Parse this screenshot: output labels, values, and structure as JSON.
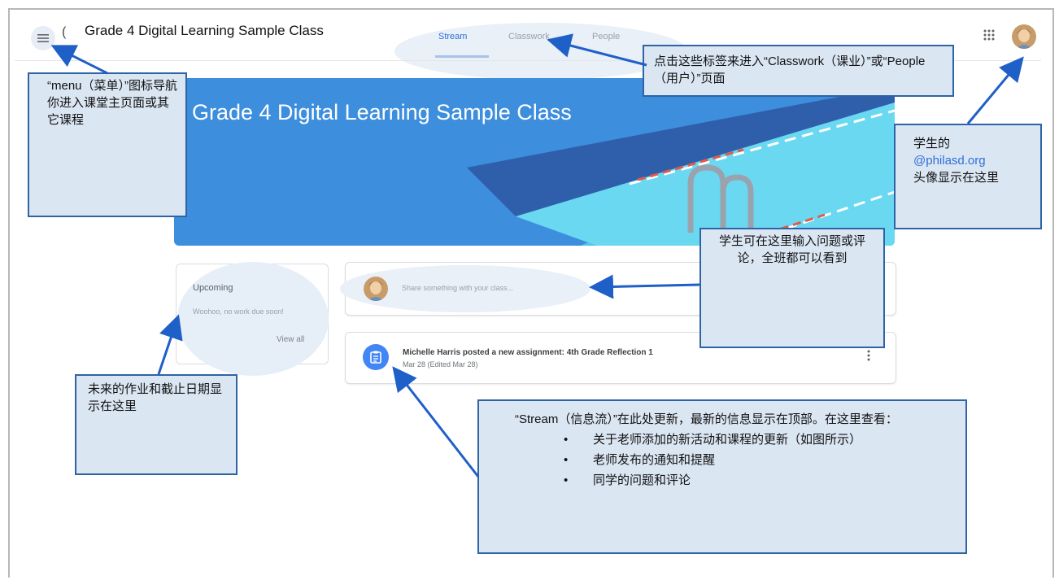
{
  "header": {
    "class_title": "Grade 4 Digital Learning Sample Class",
    "tabs": [
      {
        "label": "Stream",
        "active": true
      },
      {
        "label": "Classwork",
        "active": false
      },
      {
        "label": "People",
        "active": false
      }
    ],
    "icons": {
      "menu": "menu-icon",
      "apps": "apps-grid-icon",
      "avatar": "user-avatar"
    }
  },
  "banner": {
    "title": "Grade 4 Digital Learning Sample Class"
  },
  "upcoming": {
    "title": "Upcoming",
    "empty_text": "Woohoo, no work due soon!",
    "view_all": "View all"
  },
  "share": {
    "placeholder": "Share something with your class..."
  },
  "post": {
    "title": "Michelle Harris posted a new assignment: 4th Grade Reflection 1",
    "date": "Mar 28 (Edited Mar 28)"
  },
  "callouts": {
    "menu": "“menu（菜单）”图标导航你进入课堂主页面或其它课程",
    "tabs": "点击这些标签来进入“Classwork（课业）”或“People（用户）”页面",
    "avatar_prefix": "学生的",
    "avatar_link": "@philasd.org",
    "avatar_suffix": "头像显示在这里",
    "share": "学生可在这里输入问题或评论，全班都可以看到",
    "upcoming": "未来的作业和截止日期显示在这里",
    "stream_intro": "“Stream（信息流）”在此处更新，最新的信息显示在顶部。在这里查看：",
    "stream_items": [
      "关于老师添加的新活动和课程的更新（如图所示）",
      "老师发布的通知和提醒",
      "同学的问题和评论"
    ]
  },
  "colors": {
    "banner": "#3e8ede",
    "callout_bg": "#dbe6f3",
    "callout_border": "#2e63a6",
    "arrow": "#1f5fc8"
  }
}
